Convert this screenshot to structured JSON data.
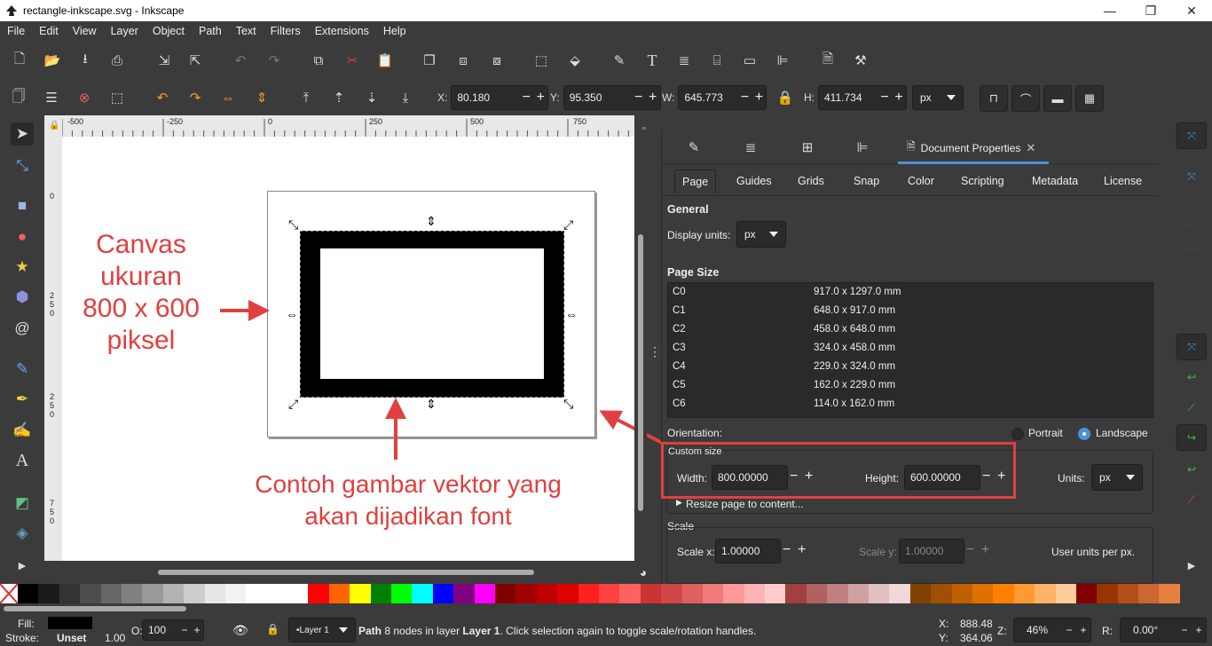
{
  "window": {
    "title": "rectangle-inkscape.svg - Inkscape",
    "minimize": "—",
    "maximize": "❐",
    "close": "✕"
  },
  "menu": [
    "File",
    "Edit",
    "View",
    "Layer",
    "Object",
    "Path",
    "Text",
    "Filters",
    "Extensions",
    "Help"
  ],
  "toolbar2": {
    "x_label": "X:",
    "x_value": "80.180",
    "y_label": "Y:",
    "y_value": "95.350",
    "w_label": "W:",
    "w_value": "645.773",
    "h_label": "H:",
    "h_value": "411.734",
    "unit": "px",
    "minus": "−",
    "plus": "+"
  },
  "rulers": {
    "top": [
      "-500",
      "-250",
      "0",
      "250",
      "500",
      "750"
    ],
    "left": [
      "0",
      "2",
      "5",
      "0",
      "2",
      "5",
      "0",
      "5",
      "0",
      "0",
      "7",
      "5",
      "0"
    ]
  },
  "annotations": {
    "canvas_note": [
      "Canvas",
      "ukuran",
      "800 x 600",
      "piksel"
    ],
    "vector_note": [
      "Contoh gambar vektor yang",
      "akan dijadikan font"
    ]
  },
  "panel": {
    "active_tab": "Document Properties",
    "tab_close": "✕",
    "subtabs": [
      "Page",
      "Guides",
      "Grids",
      "Snap",
      "Color",
      "Scripting",
      "Metadata",
      "License"
    ],
    "general_title": "General",
    "display_units_label": "Display units:",
    "display_units_value": "px",
    "page_size_title": "Page Size",
    "page_sizes": [
      {
        "name": "C0",
        "size": "917.0 x 1297.0 mm"
      },
      {
        "name": "C1",
        "size": "648.0 x 917.0 mm"
      },
      {
        "name": "C2",
        "size": "458.0 x 648.0 mm"
      },
      {
        "name": "C3",
        "size": "324.0 x 458.0 mm"
      },
      {
        "name": "C4",
        "size": "229.0 x 324.0 mm"
      },
      {
        "name": "C5",
        "size": "162.0 x 229.0 mm"
      },
      {
        "name": "C6",
        "size": "114.0 x 162.0 mm"
      }
    ],
    "orientation_label": "Orientation:",
    "portrait": "Portrait",
    "landscape": "Landscape",
    "custom_size_title": "Custom size",
    "width_label": "Width:",
    "width_value": "800.00000",
    "height_label": "Height:",
    "height_value": "600.00000",
    "units_label": "Units:",
    "units_value": "px",
    "resize_label": "Resize page to content...",
    "scale_title": "Scale",
    "scale_x_label": "Scale x:",
    "scale_x_value": "1.00000",
    "scale_y_label": "Scale y:",
    "scale_y_value": "1.00000",
    "user_units": "User units per px."
  },
  "status": {
    "fill_label": "Fill:",
    "stroke_label": "Stroke:",
    "stroke_value": "Unset",
    "stroke_width": "1.00",
    "opacity_label": "O:",
    "opacity_value": "100",
    "layer": "•Layer 1",
    "message_bold1": "Path",
    "message_text1": " 8 nodes in layer ",
    "message_bold2": "Layer 1",
    "message_text2": ". Click selection again to toggle scale/rotation handles.",
    "cx_label": "X:",
    "cx_value": "888.48",
    "cy_label": "Y:",
    "cy_value": "364.06",
    "zoom_label": "Z:",
    "zoom_value": "46%",
    "rot_label": "R:",
    "rot_value": "0.00°"
  },
  "colors": {
    "accent": "#4a90d9",
    "annotation": "#e0403f",
    "background": "#3b3b3b"
  },
  "palette": [
    "#000000",
    "#1a1a1a",
    "#333333",
    "#4d4d4d",
    "#666666",
    "#808080",
    "#999999",
    "#b3b3b3",
    "#cccccc",
    "#e6e6e6",
    "#f2f2f2",
    "#ffffff",
    "#ffffff",
    "#ffffff",
    "#ff0000",
    "#ff6600",
    "#ffff00",
    "#008000",
    "#00ff00",
    "#00ffff",
    "#0000ff",
    "#800080",
    "#ff00ff",
    "#800000",
    "#a00000",
    "#c00000",
    "#e00000",
    "#ff2020",
    "#ff4040",
    "#ff6060",
    "#cc3333",
    "#d04545",
    "#e06060",
    "#f07a7a",
    "#ff9999",
    "#ffb3b3",
    "#ffcccc",
    "#a04040",
    "#b06060",
    "#c08080",
    "#d0a0a0",
    "#e0c0c0",
    "#f0d8d8",
    "#804000",
    "#a05000",
    "#c06000",
    "#e07000",
    "#ff8000",
    "#ff9933",
    "#ffb366",
    "#ffcc99",
    "#800000",
    "#993300",
    "#b34d1a",
    "#cc6633",
    "#e68040"
  ]
}
